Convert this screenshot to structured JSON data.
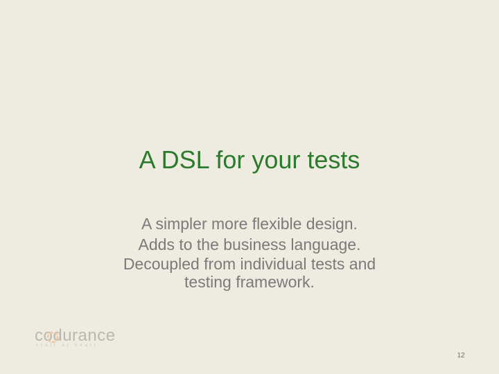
{
  "slide": {
    "title": "A DSL for your tests",
    "lines": [
      "A simpler more flexible design.",
      "Adds to the business language.",
      "Decoupled from individual tests and",
      "testing framework."
    ],
    "page_number": "12"
  },
  "logo": {
    "wordmark": "codurance",
    "tagline": "craft at heart",
    "accent_color": "#f2c49a"
  },
  "colors": {
    "background": "#eeebe1",
    "title": "#2c7a2c",
    "body": "#7a7a7a"
  }
}
